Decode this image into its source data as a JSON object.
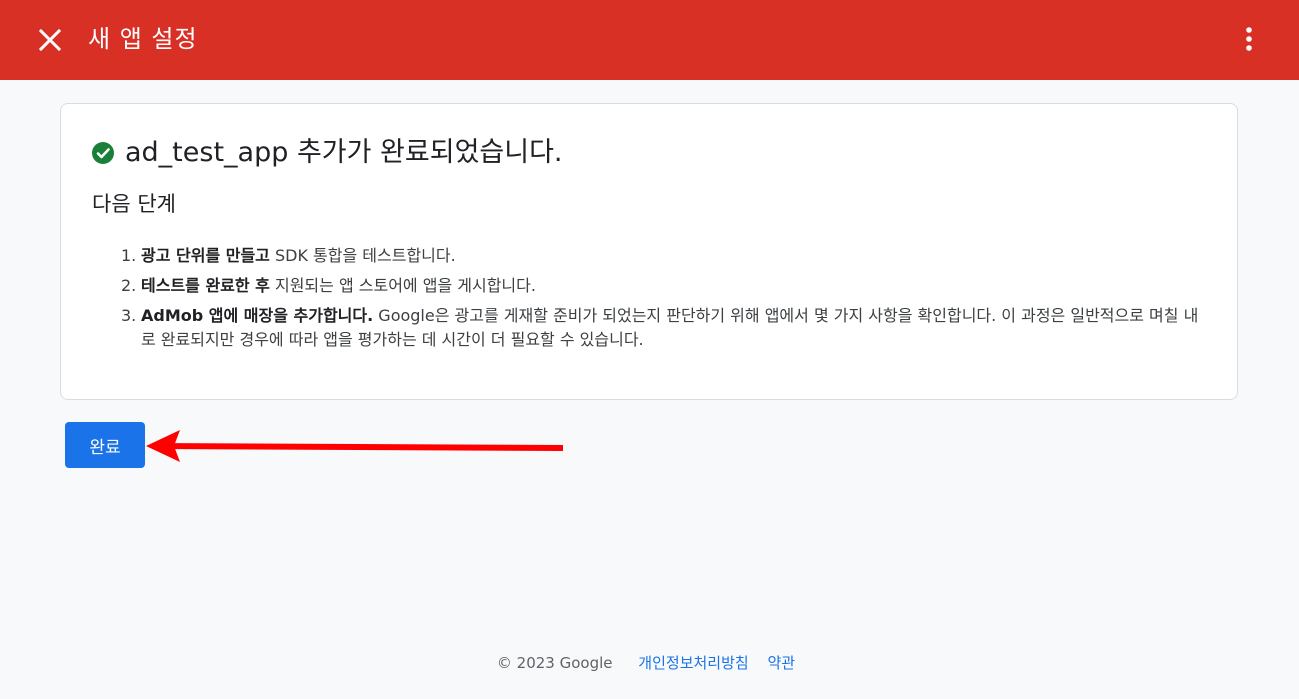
{
  "header": {
    "title": "새 앱 설정",
    "close_icon": "close-icon",
    "menu_icon": "more-vert-icon",
    "background_color": "#d93025"
  },
  "card": {
    "success_icon": "check-circle-icon",
    "success_color": "#188038",
    "success_title": "ad_test_app 추가가 완료되었습니다.",
    "next_steps_title": "다음 단계",
    "steps": [
      {
        "number": "1.",
        "bold": "광고 단위를 만들고",
        "text": " SDK 통합을 테스트합니다."
      },
      {
        "number": "2.",
        "bold": "테스트를 완료한 후",
        "text": " 지원되는 앱 스토어에 앱을 게시합니다."
      },
      {
        "number": "3.",
        "bold": "AdMob 앱에 매장을 추가합니다.",
        "text": " Google은 광고를 게재할 준비가 되었는지 판단하기 위해 앱에서 몇 가지 사항을 확인합니다. 이 과정은 일반적으로 며칠 내로 완료되지만 경우에 따라 앱을 평가하는 데 시간이 더 필요할 수 있습니다."
      }
    ]
  },
  "actions": {
    "done_label": "완료",
    "button_color": "#1a73e8"
  },
  "annotation": {
    "arrow_color": "#ff0000"
  },
  "footer": {
    "copyright": "© 2023 Google",
    "privacy_link": "개인정보처리방침",
    "terms_link": "약관"
  }
}
